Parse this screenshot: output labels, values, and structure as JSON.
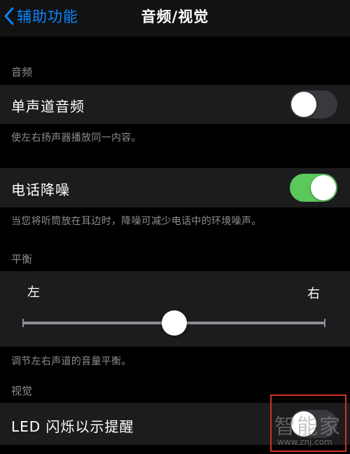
{
  "nav": {
    "back_label": "辅助功能",
    "title": "音频/视觉"
  },
  "audio": {
    "header": "音频",
    "mono": {
      "label": "单声道音频",
      "state": "off"
    },
    "mono_footer": "使左右扬声器播放同一内容。",
    "noise": {
      "label": "电话降噪",
      "state": "on"
    },
    "noise_footer": "当您将听筒放在耳边时，降噪可减少电话中的环境噪声。"
  },
  "balance": {
    "header": "平衡",
    "left_label": "左",
    "right_label": "右",
    "value": 0.5,
    "footer": "调节左右声道的音量平衡。"
  },
  "visual": {
    "header": "视觉",
    "led": {
      "label": "LED 闪烁以示提醒",
      "state": "off"
    }
  },
  "watermark": {
    "logo": "智能家",
    "url": "www.znj.com"
  },
  "colors": {
    "accent": "#0a84ff",
    "toggle_on": "#5ac85a",
    "toggle_off": "#39393d",
    "highlight": "#d0302a"
  }
}
